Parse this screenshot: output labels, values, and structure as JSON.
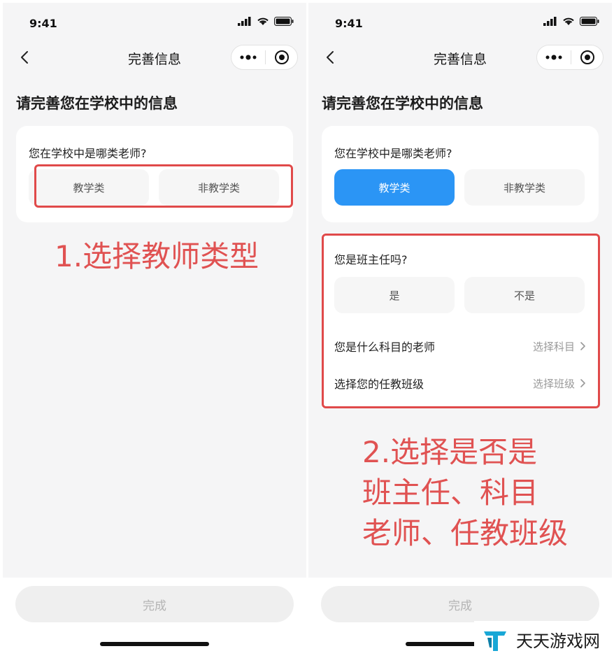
{
  "status_bar": {
    "time": "9:41"
  },
  "nav": {
    "title": "完善信息"
  },
  "page": {
    "heading": "请完善您在学校中的信息"
  },
  "teacher_type": {
    "question": "您在学校中是哪类老师?",
    "options": [
      "教学类",
      "非教学类"
    ]
  },
  "left_screen": {
    "selected_option": null,
    "annotation": "1.选择教师类型"
  },
  "right_screen": {
    "selected_option": "教学类",
    "homeroom": {
      "question": "您是班主任吗?",
      "options": [
        "是",
        "不是"
      ]
    },
    "subject": {
      "label": "您是什么科目的老师",
      "placeholder": "选择科目"
    },
    "classes": {
      "label": "选择您的任教班级",
      "placeholder": "选择班级"
    },
    "annotation": "2.选择是否是\n班主任、科目\n老师、任教班级"
  },
  "footer": {
    "done_label": "完成"
  },
  "watermark": {
    "text": "天天游戏网"
  },
  "colors": {
    "accent": "#2b95f5",
    "annotation": "#e05252",
    "highlight": "#e04a4a"
  }
}
